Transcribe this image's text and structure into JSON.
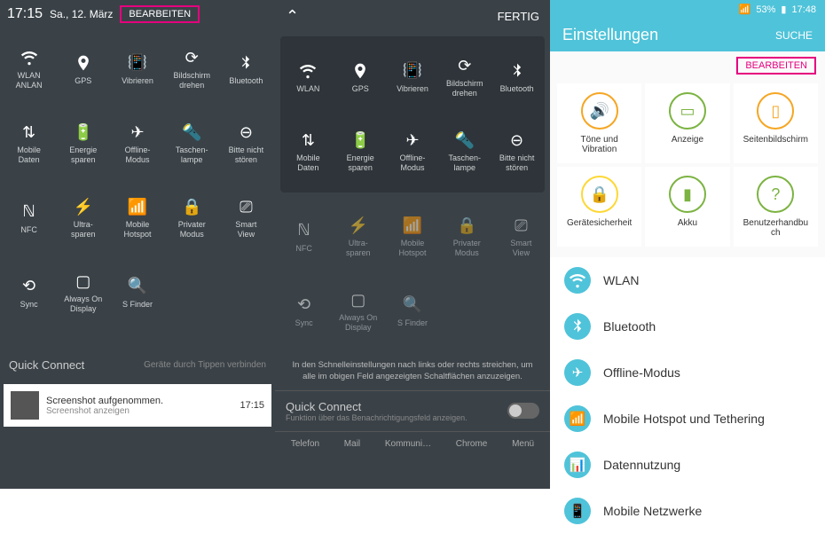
{
  "panel1": {
    "time": "17:15",
    "date": "Sa., 12. März",
    "edit": "BEARBEITEN",
    "tiles": [
      {
        "label": "WLAN\nANLAN",
        "icon": "wifi"
      },
      {
        "label": "GPS",
        "icon": "pin"
      },
      {
        "label": "Vibrieren",
        "icon": "vibrate"
      },
      {
        "label": "Bildschirm\ndrehen",
        "icon": "rotate"
      },
      {
        "label": "Bluetooth",
        "icon": "bt"
      },
      {
        "label": "Mobile\nDaten",
        "icon": "data"
      },
      {
        "label": "Energie\nsparen",
        "icon": "battery"
      },
      {
        "label": "Offline-\nModus",
        "icon": "plane"
      },
      {
        "label": "Taschen-\nlampe",
        "icon": "torch"
      },
      {
        "label": "Bitte nicht\nstören",
        "icon": "dnd"
      },
      {
        "label": "NFC",
        "icon": "nfc"
      },
      {
        "label": "Ultra-\nsparen",
        "icon": "ultra"
      },
      {
        "label": "Mobile\nHotspot",
        "icon": "hotspot"
      },
      {
        "label": "Privater\nModus",
        "icon": "private"
      },
      {
        "label": "Smart\nView",
        "icon": "cast"
      },
      {
        "label": "Sync",
        "icon": "sync"
      },
      {
        "label": "Always On\nDisplay",
        "icon": "aod"
      },
      {
        "label": "S Finder",
        "icon": "search"
      }
    ],
    "quickConnect": "Quick Connect",
    "quickConnectSub": "Geräte durch Tippen verbinden",
    "notifTitle": "Screenshot aufgenommen.",
    "notifSub": "Screenshot anzeigen",
    "notifTime": "17:15"
  },
  "panel2": {
    "done": "FERTIG",
    "tilesA": [
      {
        "label": "WLAN",
        "icon": "wifi"
      },
      {
        "label": "GPS",
        "icon": "pin"
      },
      {
        "label": "Vibrieren",
        "icon": "vibrate"
      },
      {
        "label": "Bildschirm\ndrehen",
        "icon": "rotate"
      },
      {
        "label": "Bluetooth",
        "icon": "bt"
      },
      {
        "label": "Mobile\nDaten",
        "icon": "data"
      },
      {
        "label": "Energie\nsparen",
        "icon": "battery"
      },
      {
        "label": "Offline-\nModus",
        "icon": "plane"
      },
      {
        "label": "Taschen-\nlampe",
        "icon": "torch"
      },
      {
        "label": "Bitte nicht\nstören",
        "icon": "dnd"
      }
    ],
    "tilesB": [
      {
        "label": "NFC",
        "icon": "nfc"
      },
      {
        "label": "Ultra-\nsparen",
        "icon": "ultra"
      },
      {
        "label": "Mobile\nHotspot",
        "icon": "hotspot"
      },
      {
        "label": "Privater\nModus",
        "icon": "private"
      },
      {
        "label": "Smart\nView",
        "icon": "cast"
      },
      {
        "label": "Sync",
        "icon": "sync"
      },
      {
        "label": "Always On\nDisplay",
        "icon": "aod"
      },
      {
        "label": "S Finder",
        "icon": "search"
      }
    ],
    "hint": "In den Schnelleinstellungen nach links oder rechts streichen, um alle im obigen Feld angezeigten Schaltflächen anzuzeigen.",
    "qc": "Quick Connect",
    "qcSub": "Funktion über das Benachrichtigungsfeld anzeigen.",
    "nav": [
      "Telefon",
      "Mail",
      "Kommuni…",
      "Chrome",
      "Menü"
    ]
  },
  "panel3": {
    "battery": "53%",
    "time": "17:48",
    "title": "Einstellungen",
    "search": "SUCHE",
    "edit": "BEARBEITEN",
    "cards": [
      {
        "label": "Töne und\nVibration",
        "color": "c-orange",
        "icon": "sound"
      },
      {
        "label": "Anzeige",
        "color": "c-green",
        "icon": "display"
      },
      {
        "label": "Seitenbildschirm",
        "color": "c-orange",
        "icon": "edge"
      },
      {
        "label": "Gerätesicherheit",
        "color": "c-yellow",
        "icon": "lock"
      },
      {
        "label": "Akku",
        "color": "c-green",
        "icon": "batt"
      },
      {
        "label": "Benutzerhandbu\nch",
        "color": "c-green",
        "icon": "help"
      }
    ],
    "list": [
      {
        "label": "WLAN",
        "icon": "wifi"
      },
      {
        "label": "Bluetooth",
        "icon": "bt"
      },
      {
        "label": "Offline-Modus",
        "icon": "plane"
      },
      {
        "label": "Mobile Hotspot und Tethering",
        "icon": "hotspot"
      },
      {
        "label": "Datennutzung",
        "icon": "chart"
      },
      {
        "label": "Mobile Netzwerke",
        "icon": "mobile"
      }
    ]
  }
}
